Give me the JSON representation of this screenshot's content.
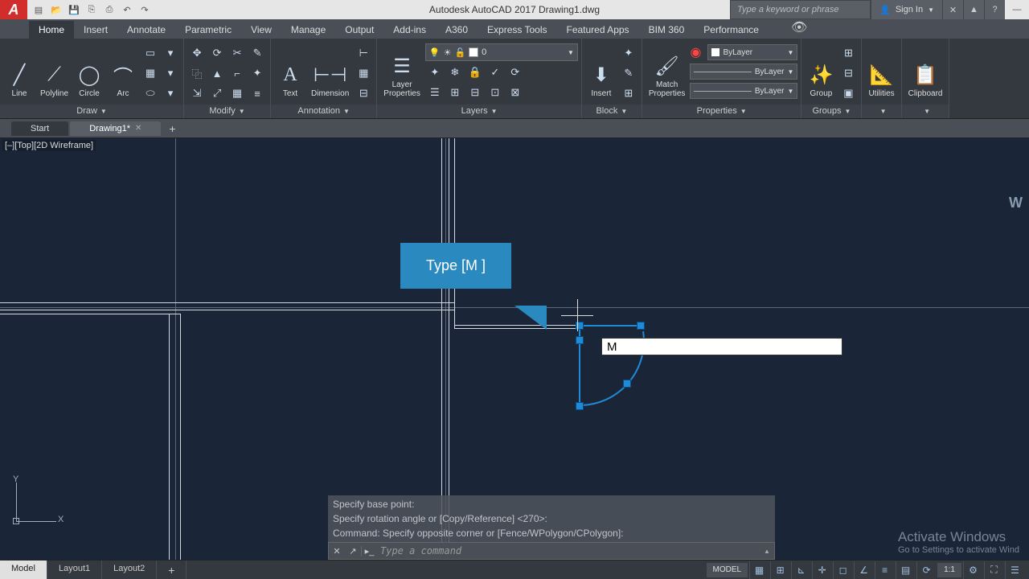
{
  "titlebar": {
    "app_letter": "A",
    "title": "Autodesk AutoCAD 2017   Drawing1.dwg",
    "search_placeholder": "Type a keyword or phrase",
    "signin": "Sign In",
    "minimize": "—"
  },
  "ribbon_tabs": [
    "Home",
    "Insert",
    "Annotate",
    "Parametric",
    "View",
    "Manage",
    "Output",
    "Add-ins",
    "A360",
    "Express Tools",
    "Featured Apps",
    "BIM 360",
    "Performance"
  ],
  "active_tab": 0,
  "panels": {
    "draw": {
      "title": "Draw",
      "buttons": [
        "Line",
        "Polyline",
        "Circle",
        "Arc"
      ]
    },
    "modify": {
      "title": "Modify"
    },
    "annotation": {
      "title": "Annotation",
      "buttons": [
        "Text",
        "Dimension"
      ]
    },
    "layers": {
      "title": "Layers",
      "button": "Layer\nProperties",
      "current": "0"
    },
    "block": {
      "title": "Block",
      "button": "Insert"
    },
    "properties": {
      "title": "Properties",
      "button": "Match\nProperties",
      "bylayer": "ByLayer"
    },
    "groups": {
      "title": "Groups",
      "button": "Group"
    },
    "utilities": {
      "title": "",
      "button": "Utilities"
    },
    "clipboard": {
      "title": "",
      "button": "Clipboard"
    }
  },
  "file_tabs": {
    "start": "Start",
    "drawing": "Drawing1*"
  },
  "canvas": {
    "view_label": "[–][Top][2D Wireframe]",
    "callout": "Type [M ]",
    "dynamic_input": "M",
    "navcube": "W",
    "ucs_y": "Y",
    "ucs_x": "X"
  },
  "command": {
    "history": [
      "Specify base point:",
      "Specify rotation angle or [Copy/Reference] <270>:",
      "Command: Specify opposite corner or [Fence/WPolygon/CPolygon]:"
    ],
    "prompt": "Type a command"
  },
  "watermark": {
    "title": "Activate Windows",
    "sub": "Go to Settings to activate Wind"
  },
  "bottom": {
    "tabs": [
      "Model",
      "Layout1",
      "Layout2"
    ],
    "model": "MODEL",
    "ratio": "1:1"
  }
}
